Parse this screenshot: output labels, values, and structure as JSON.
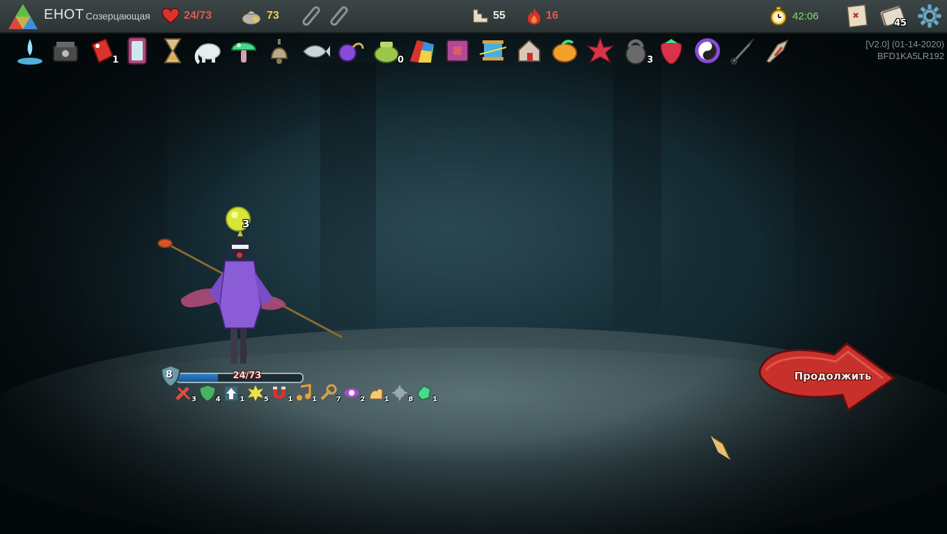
{
  "player": {
    "name": "ЕНОТ",
    "title": "Созерцающая"
  },
  "topbar": {
    "hp": "24/73",
    "gold": "73",
    "floor": "55",
    "ascension": "16",
    "timer": "42:06",
    "deck_count": "45"
  },
  "relics": [
    {
      "icon": "water-drop-icon",
      "count": ""
    },
    {
      "icon": "cauldron-box-icon",
      "count": ""
    },
    {
      "icon": "red-tag-icon",
      "count": "1"
    },
    {
      "icon": "mirror-icon",
      "count": ""
    },
    {
      "icon": "hourglass-icon",
      "count": ""
    },
    {
      "icon": "white-elephant-icon",
      "count": ""
    },
    {
      "icon": "green-mushroom-icon",
      "count": ""
    },
    {
      "icon": "bell-icon",
      "count": ""
    },
    {
      "icon": "fish-icon",
      "count": ""
    },
    {
      "icon": "purple-orb-icon",
      "count": ""
    },
    {
      "icon": "green-pot-icon",
      "count": "0"
    },
    {
      "icon": "rainbow-prism-icon",
      "count": ""
    },
    {
      "icon": "pink-box-icon",
      "count": ""
    },
    {
      "icon": "spool-icon",
      "count": ""
    },
    {
      "icon": "house-icon",
      "count": ""
    },
    {
      "icon": "mango-icon",
      "count": ""
    },
    {
      "icon": "red-star-icon",
      "count": ""
    },
    {
      "icon": "kettlebell-icon",
      "count": "3"
    },
    {
      "icon": "strawberry-icon",
      "count": ""
    },
    {
      "icon": "yin-yang-icon",
      "count": ""
    },
    {
      "icon": "kunai-icon",
      "count": ""
    },
    {
      "icon": "shuriken-tool-icon",
      "count": ""
    }
  ],
  "version": {
    "line1": "[V2.0] (01-14-2020)",
    "line2": "BFD1KA5LR192"
  },
  "creature": {
    "hp_text": "24/73",
    "hp_fraction": 0.329,
    "block": "8",
    "orb_count": "3"
  },
  "powers": [
    {
      "icon": "no-attack-icon",
      "count": "3"
    },
    {
      "icon": "green-shield-icon",
      "count": "4"
    },
    {
      "icon": "up-arrow-icon",
      "count": "1"
    },
    {
      "icon": "yellow-burst-icon",
      "count": "5"
    },
    {
      "icon": "magnet-icon",
      "count": "1"
    },
    {
      "icon": "music-note-icon",
      "count": "1"
    },
    {
      "icon": "wrench-icon",
      "count": "7"
    },
    {
      "icon": "eye-icon",
      "count": "2"
    },
    {
      "icon": "flex-arm-icon",
      "count": "1"
    },
    {
      "icon": "spiky-ball-icon",
      "count": "8"
    },
    {
      "icon": "green-crystal-icon",
      "count": "1"
    }
  ],
  "proceed": {
    "label": "Продолжить"
  },
  "colors": {
    "hp_red": "#e05a4e",
    "gold": "#f2d04a",
    "timer_green": "#7de05a",
    "proceed_red": "#c8302c"
  }
}
